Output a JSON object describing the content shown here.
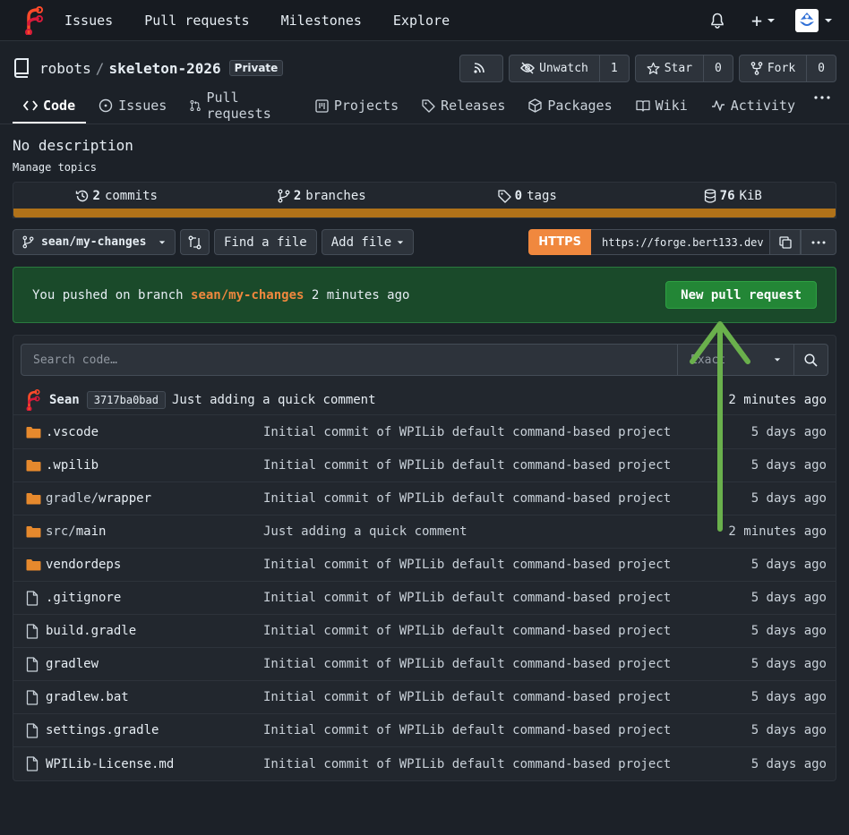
{
  "nav": {
    "links": [
      "Issues",
      "Pull requests",
      "Milestones",
      "Explore"
    ],
    "plus": "+"
  },
  "repo": {
    "owner": "robots",
    "separator": "/",
    "name": "skeleton-2026",
    "visibility": "Private",
    "unwatch_label": "Unwatch",
    "watch_count": "1",
    "star_label": "Star",
    "star_count": "0",
    "fork_label": "Fork",
    "fork_count": "0"
  },
  "tabs": [
    {
      "label": "Code",
      "icon": "code-icon",
      "active": true
    },
    {
      "label": "Issues",
      "icon": "issue-icon"
    },
    {
      "label": "Pull requests",
      "icon": "pull-request-icon"
    },
    {
      "label": "Projects",
      "icon": "project-icon"
    },
    {
      "label": "Releases",
      "icon": "tag-icon"
    },
    {
      "label": "Packages",
      "icon": "package-icon"
    },
    {
      "label": "Wiki",
      "icon": "book-icon"
    },
    {
      "label": "Activity",
      "icon": "pulse-icon"
    }
  ],
  "description": "No description",
  "manage_topics": "Manage topics",
  "stats": {
    "commits_count": "2",
    "commits_label": "commits",
    "branches_count": "2",
    "branches_label": "branches",
    "tags_count": "0",
    "tags_label": "tags",
    "size_count": "76",
    "size_label": "KiB",
    "language_color": "#b07219"
  },
  "toolbar": {
    "branch": "sean/my-changes",
    "find_file": "Find a file",
    "add_file": "Add file",
    "protocol": "HTTPS",
    "clone_url": "https://forge.bert133.dev"
  },
  "banner": {
    "prefix": "You pushed on branch",
    "branch": "sean/my-changes",
    "suffix": "2 minutes ago",
    "button": "New pull request"
  },
  "search": {
    "placeholder": "Search code…",
    "mode": "Exact"
  },
  "latest_commit": {
    "author": "Sean",
    "sha": "3717ba0bad",
    "message": "Just adding a quick comment",
    "time": "2 minutes ago"
  },
  "files": [
    {
      "type": "dir",
      "prefix": "",
      "name": ".vscode",
      "message": "Initial commit of WPILib default command-based project",
      "time": "5 days ago"
    },
    {
      "type": "dir",
      "prefix": "",
      "name": ".wpilib",
      "message": "Initial commit of WPILib default command-based project",
      "time": "5 days ago"
    },
    {
      "type": "dir",
      "prefix": "gradle/",
      "name": "wrapper",
      "message": "Initial commit of WPILib default command-based project",
      "time": "5 days ago"
    },
    {
      "type": "dir",
      "prefix": "src/",
      "name": "main",
      "message": "Just adding a quick comment",
      "time": "2 minutes ago"
    },
    {
      "type": "dir",
      "prefix": "",
      "name": "vendordeps",
      "message": "Initial commit of WPILib default command-based project",
      "time": "5 days ago"
    },
    {
      "type": "file",
      "prefix": "",
      "name": ".gitignore",
      "message": "Initial commit of WPILib default command-based project",
      "time": "5 days ago"
    },
    {
      "type": "file",
      "prefix": "",
      "name": "build.gradle",
      "message": "Initial commit of WPILib default command-based project",
      "time": "5 days ago"
    },
    {
      "type": "file",
      "prefix": "",
      "name": "gradlew",
      "message": "Initial commit of WPILib default command-based project",
      "time": "5 days ago"
    },
    {
      "type": "file",
      "prefix": "",
      "name": "gradlew.bat",
      "message": "Initial commit of WPILib default command-based project",
      "time": "5 days ago"
    },
    {
      "type": "file",
      "prefix": "",
      "name": "settings.gradle",
      "message": "Initial commit of WPILib default command-based project",
      "time": "5 days ago"
    },
    {
      "type": "file",
      "prefix": "",
      "name": "WPILib-License.md",
      "message": "Initial commit of WPILib default command-based project",
      "time": "5 days ago"
    }
  ],
  "colors": {
    "accent_orange": "#f0883e",
    "banner_bg": "#1a4a2a",
    "pr_button": "#238636",
    "annotation_arrow": "#6ab04c"
  }
}
